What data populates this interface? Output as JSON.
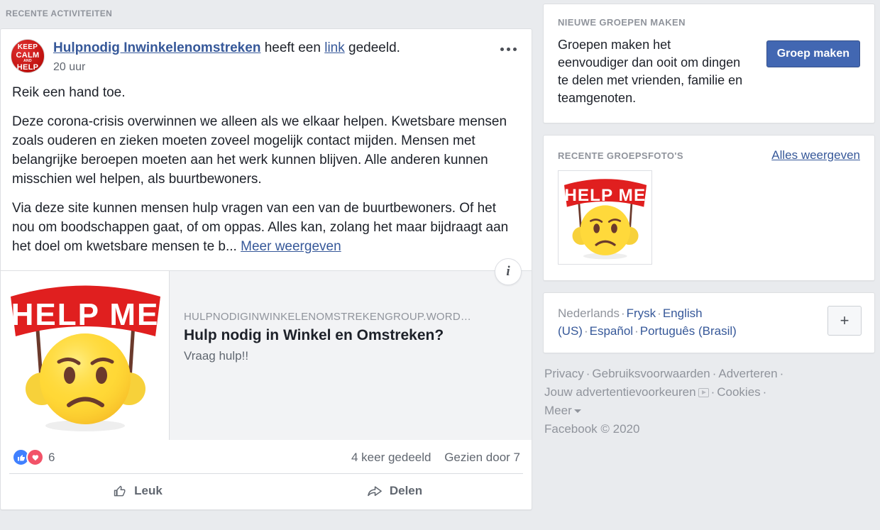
{
  "left": {
    "section_heading": "RECENTE ACTIVITEITEN",
    "post": {
      "avatar": {
        "name": "keep-calm-and-help-avatar",
        "line1": "KEEP",
        "line2": "CALM",
        "line3": "AND",
        "line4": "HELP",
        "color": "#c0120f"
      },
      "author": "Hulpnodig Inwinkelenomstreken",
      "action_prefix": " heeft een ",
      "action_link": "link",
      "action_suffix": " gedeeld.",
      "timestamp": "20 uur",
      "menu_icon": "ellipsis-icon",
      "body_paragraph_1": "Reik een hand toe.",
      "body_paragraph_2": "Deze corona-crisis overwinnen we alleen als we elkaar helpen. Kwetsbare mensen zoals ouderen en zieken moeten zoveel mogelijk contact mijden. Mensen met belangrijke beroepen moeten aan het werk kunnen blijven. Alle anderen kunnen misschien wel helpen, als buurtbewoners.",
      "body_paragraph_3": "Via deze site kunnen mensen hulp vragen van een van de buurtbewoners. Of het nou om boodschappen gaat, of om oppas. Alles kan, zolang het maar bijdraagt aan het doel om kwetsbare mensen te b...",
      "see_more": "Meer weergeven",
      "attachment": {
        "image_alt": "help-me-emoji",
        "image_caption": "HELP ME",
        "domain": "HULPNODIGINWINKELENOMSTREKENGROUP.WORD…",
        "title": "Hulp nodig in Winkel en Omstreken?",
        "description": "Vraag hulp!!",
        "info_badge": "i"
      },
      "reactions": {
        "like_icon": "thumbs-up-reaction-icon",
        "love_icon": "heart-reaction-icon",
        "count": "6"
      },
      "shares": "4 keer gedeeld",
      "views": "Gezien door 7",
      "like_label": "Leuk",
      "like_icon": "thumbs-up-icon",
      "share_label": "Delen",
      "share_icon": "share-arrow-icon"
    }
  },
  "right": {
    "groups_card": {
      "title": "NIEUWE GROEPEN MAKEN",
      "blurb": "Groepen maken het eenvoudiger dan ooit om dingen te delen met vrienden, familie en teamgenoten.",
      "button_label": "Groep maken",
      "button_color": "#4267b2"
    },
    "photos_card": {
      "title": "RECENTE GROEPSFOTO'S",
      "see_all": "Alles weergeven",
      "thumb_alt": "help-me-emoji-thumbnail",
      "thumb_caption": "HELP ME"
    },
    "languages": {
      "current": "Nederlands",
      "items": [
        "Frysk",
        "English (US)",
        "Español",
        "Português (Brasil)"
      ],
      "add_button": "+"
    },
    "footer": {
      "links": [
        "Privacy",
        "Gebruiksvoorwaarden",
        "Adverteren",
        "Jouw advertentievoorkeuren",
        "Cookies",
        "Meer"
      ],
      "adchoices_icon": "adchoices-icon",
      "copyright": "Facebook © 2020"
    }
  }
}
